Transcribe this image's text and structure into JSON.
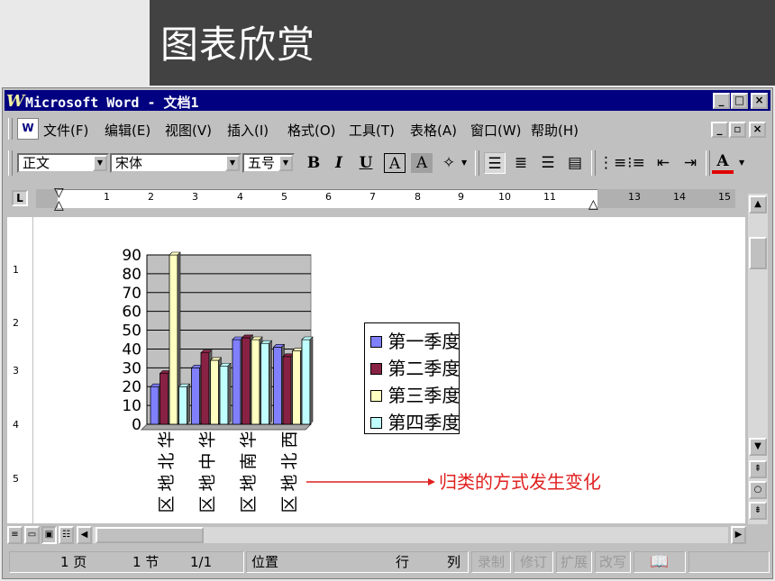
{
  "slide": {
    "title": "图表欣赏"
  },
  "window": {
    "app_icon": "W",
    "title": "Microsoft Word - 文档1",
    "controls": [
      "_",
      "□",
      "×"
    ],
    "doc_controls": [
      "_",
      "▫",
      "×"
    ]
  },
  "menu": [
    "文件(F)",
    "编辑(E)",
    "视图(V)",
    "插入(I)",
    "格式(O)",
    "工具(T)",
    "表格(A)",
    "窗口(W)",
    "帮助(H)"
  ],
  "toolbar": {
    "style": "正文",
    "font": "宋体",
    "size": "五号",
    "bold": "B",
    "italic": "I",
    "underline": "U",
    "char_border": "A",
    "char_shading": "A",
    "font_color": "A",
    "icons": [
      "align-justify-icon",
      "align-center-icon",
      "align-right-icon",
      "distribute-icon",
      "numbering-icon",
      "bullets-icon",
      "decrease-indent-icon",
      "increase-indent-icon"
    ]
  },
  "ruler": {
    "tab_marker": "L",
    "numbers": [
      "1",
      "2",
      "3",
      "4",
      "5",
      "6",
      "7",
      "8",
      "9",
      "10",
      "11",
      "13",
      "14",
      "15"
    ]
  },
  "vruler": {
    "numbers": [
      "1",
      "2",
      "3",
      "4",
      "5"
    ]
  },
  "chart_data": {
    "type": "bar",
    "categories": [
      "华北地区",
      "华中地区",
      "华南地区",
      "西北地区"
    ],
    "series": [
      {
        "name": "第一季度",
        "values": [
          20,
          30,
          45,
          41
        ],
        "color": "#8080ff"
      },
      {
        "name": "第二季度",
        "values": [
          27,
          38,
          46,
          36
        ],
        "color": "#882244"
      },
      {
        "name": "第三季度",
        "values": [
          90,
          34,
          45,
          39
        ],
        "color": "#ffffc0"
      },
      {
        "name": "第四季度",
        "values": [
          20,
          31,
          43,
          45
        ],
        "color": "#c0ffff"
      }
    ],
    "ylim": [
      0,
      90
    ],
    "yticks": [
      "0",
      "10",
      "20",
      "30",
      "40",
      "50",
      "60",
      "70",
      "80",
      "90"
    ],
    "grid": true,
    "legend_position": "right"
  },
  "annotation": "归类的方式发生变化",
  "annotation_color": "#e02020",
  "status": {
    "page": "1 页",
    "section": "1 节",
    "pages": "1/1",
    "position": "位置",
    "line": "行",
    "col": "列",
    "rec": "录制",
    "trk": "修订",
    "ext": "扩展",
    "ovr": "改写"
  }
}
